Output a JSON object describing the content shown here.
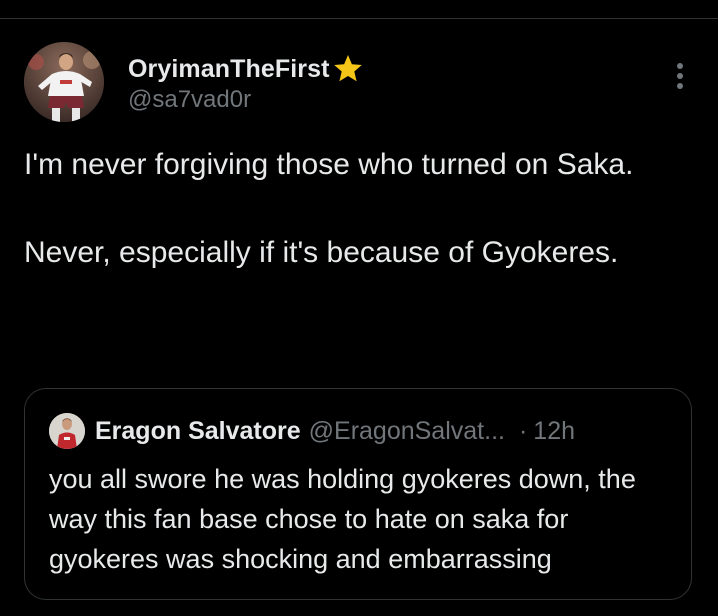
{
  "tweet": {
    "author": {
      "display_name": "OryimanTheFirst",
      "handle": "@sa7vad0r",
      "badge_icon": "star-icon",
      "badge_color": "#f5c518"
    },
    "more_icon": "more-vertical-icon",
    "text": "I'm never forgiving those who turned on Saka.\n\nNever, especially if it's because of Gyokeres."
  },
  "quote": {
    "author": {
      "display_name": "Eragon Salvatore",
      "handle": "@EragonSalvat...",
      "separator": "·",
      "time": "12h"
    },
    "text": "you all swore he was holding gyokeres down, the way this fan base chose to hate on saka for gyokeres was shocking and embarrassing"
  },
  "colors": {
    "background": "#000000",
    "primary_text": "#e7e9ea",
    "secondary_text": "#71767b",
    "border": "#2f3336"
  }
}
